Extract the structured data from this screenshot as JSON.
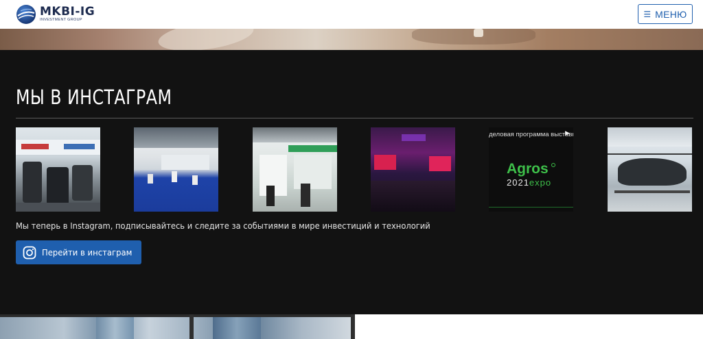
{
  "header": {
    "logo_main": "MKBI-IG",
    "logo_sub": "INVESTMENT GROUP",
    "menu_label": "МЕНЮ",
    "menu_icon": "hamburger-icon",
    "burger_glyph": "☰"
  },
  "instagram": {
    "title": "МЫ В ИНСТАГРАМ",
    "description": "Мы теперь в Instagram, подписывайтесь и следите за событиями в мире инвестиций и технологий",
    "button_label": "Перейти в инстаграм",
    "button_icon": "instagram-icon",
    "posts": [
      {
        "kind": "photo",
        "subject": "exhibition-booth-machinery"
      },
      {
        "kind": "photo",
        "subject": "exhibition-hall-blue-floor"
      },
      {
        "kind": "photo",
        "subject": "exhibition-stand"
      },
      {
        "kind": "photo",
        "subject": "conference-audience"
      },
      {
        "kind": "video",
        "caption": "деловая программа выставки",
        "brand": "Agros",
        "year": "2021",
        "suffix": "expo"
      },
      {
        "kind": "photo",
        "subject": "helicopter-exhibit"
      }
    ]
  },
  "colors": {
    "accent": "#1f5fae",
    "section_bg": "#121212",
    "agros_green": "#3ec04a"
  }
}
